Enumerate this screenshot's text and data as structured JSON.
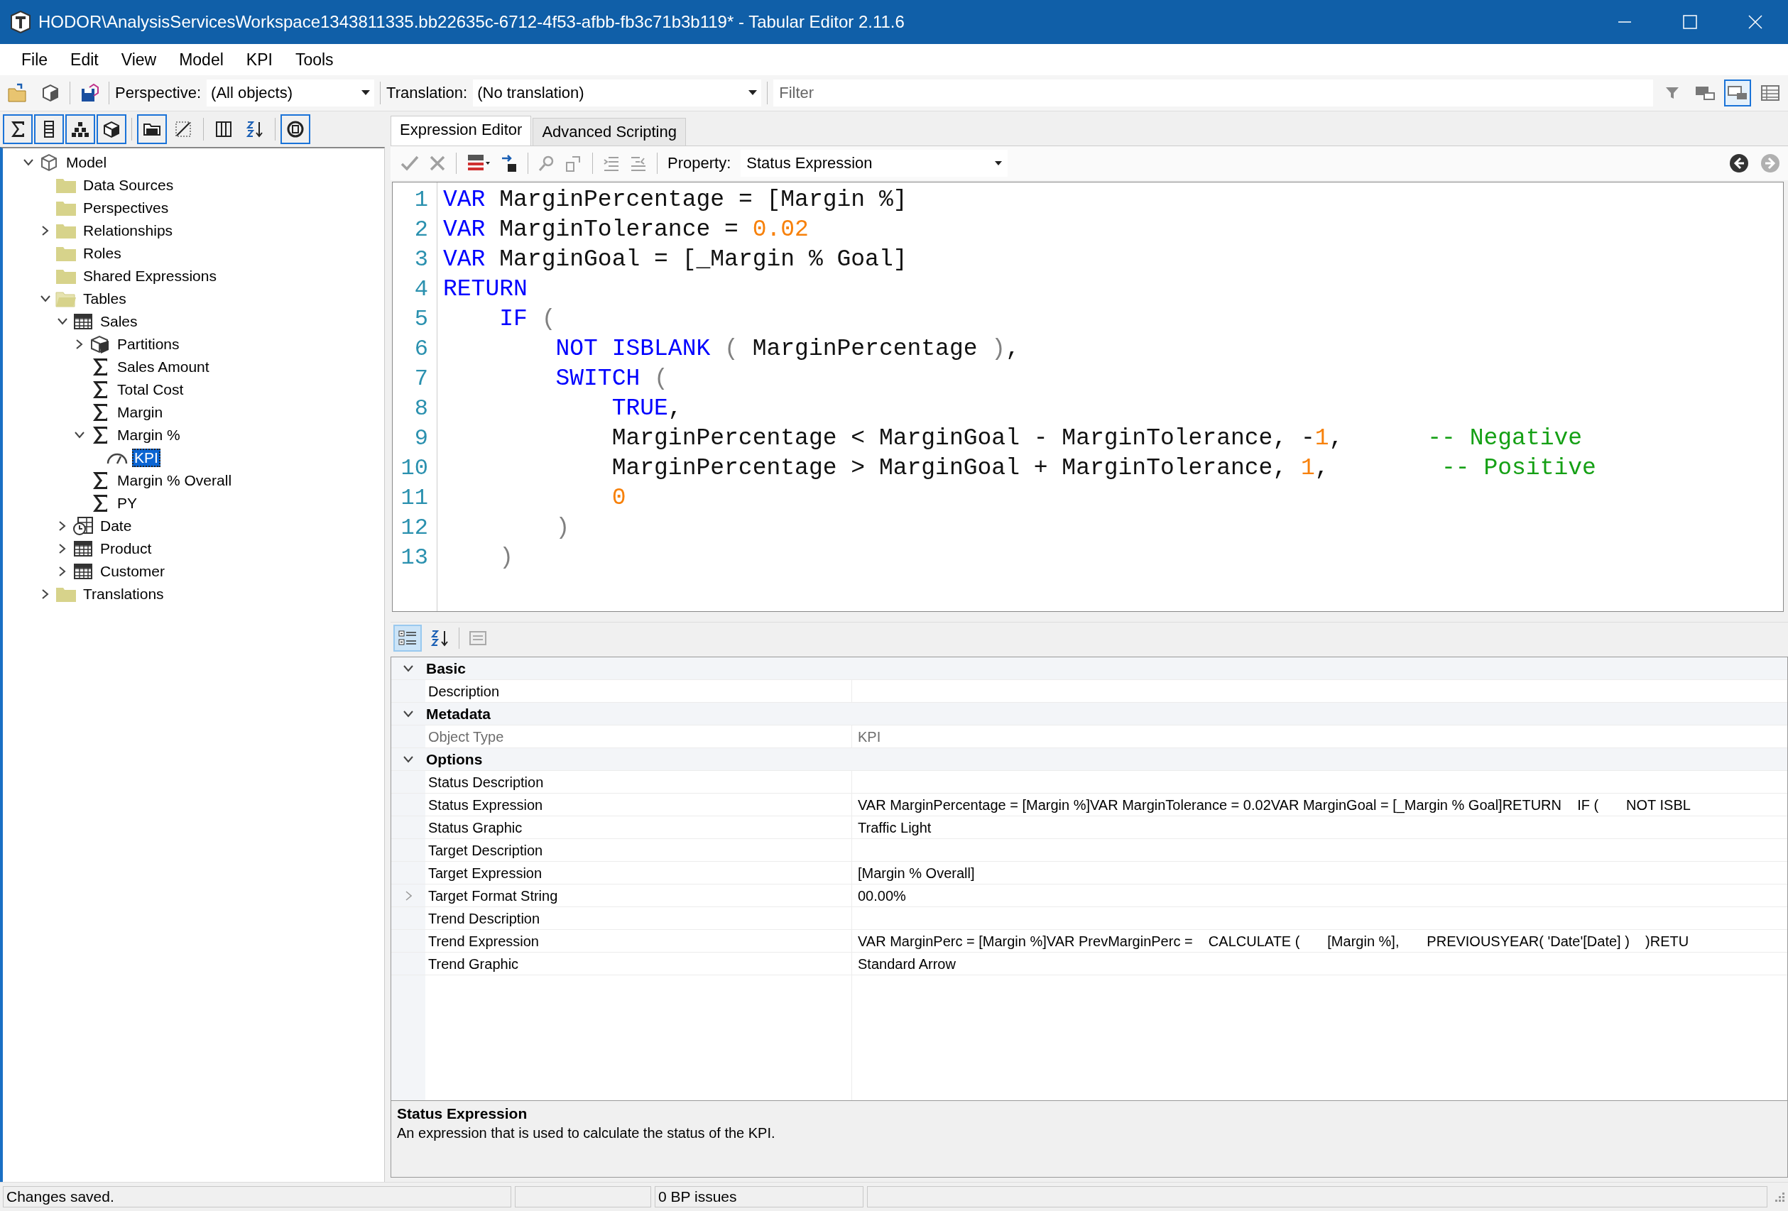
{
  "window": {
    "title": "HODOR\\AnalysisServicesWorkspace1343811335.bb22635c-6712-4f53-afbb-fb3c71b3b119* - Tabular Editor 2.11.6"
  },
  "menu": [
    "File",
    "Edit",
    "View",
    "Model",
    "KPI",
    "Tools"
  ],
  "toolbar": {
    "perspective": {
      "label": "Perspective:",
      "value": "(All objects)"
    },
    "translation": {
      "label": "Translation:",
      "value": "(No translation)"
    },
    "filter": {
      "placeholder": "Filter"
    },
    "view_buttons": [
      {
        "kind": "filter",
        "on": false
      },
      {
        "kind": "grid-view",
        "on": false
      },
      {
        "kind": "tree-view",
        "on": true
      },
      {
        "kind": "list-view",
        "on": false
      }
    ]
  },
  "tree_toolbar": [
    {
      "kind": "sigma",
      "on": true
    },
    {
      "kind": "column",
      "on": true
    },
    {
      "kind": "hierarchy",
      "on": true
    },
    {
      "kind": "cube",
      "on": true
    },
    {
      "kind": "folder",
      "on": true
    },
    {
      "kind": "diagonal",
      "on": false
    },
    {
      "kind": "columns",
      "on": false
    },
    {
      "kind": "sort",
      "on": false
    },
    {
      "kind": "circle",
      "on": true
    }
  ],
  "tree": [
    {
      "label": "Model",
      "kind": "model",
      "expanded": true,
      "selected": false,
      "children": [
        {
          "label": "Data Sources",
          "kind": "folder",
          "selected": false
        },
        {
          "label": "Perspectives",
          "kind": "folder",
          "selected": false
        },
        {
          "label": "Relationships",
          "kind": "folder",
          "expanded": false,
          "selected": false
        },
        {
          "label": "Roles",
          "kind": "folder",
          "selected": false
        },
        {
          "label": "Shared Expressions",
          "kind": "folder",
          "selected": false
        },
        {
          "label": "Tables",
          "kind": "folder-open",
          "expanded": true,
          "selected": false,
          "children": [
            {
              "label": "Sales",
              "kind": "table",
              "expanded": true,
              "selected": false,
              "children": [
                {
                  "label": "Partitions",
                  "kind": "partitions",
                  "expanded": false,
                  "selected": false
                },
                {
                  "label": "Sales Amount",
                  "kind": "measure",
                  "selected": false
                },
                {
                  "label": "Total Cost",
                  "kind": "measure",
                  "selected": false
                },
                {
                  "label": "Margin",
                  "kind": "measure",
                  "selected": false
                },
                {
                  "label": "Margin %",
                  "kind": "measure",
                  "expanded": true,
                  "selected": false,
                  "children": [
                    {
                      "label": "KPI",
                      "kind": "kpi",
                      "selected": true
                    }
                  ]
                },
                {
                  "label": "Margin % Overall",
                  "kind": "measure",
                  "selected": false
                },
                {
                  "label": "PY",
                  "kind": "measure",
                  "selected": false
                }
              ]
            },
            {
              "label": "Date",
              "kind": "date-table",
              "expanded": false,
              "selected": false
            },
            {
              "label": "Product",
              "kind": "table",
              "expanded": false,
              "selected": false
            },
            {
              "label": "Customer",
              "kind": "table",
              "expanded": false,
              "selected": false
            }
          ]
        },
        {
          "label": "Translations",
          "kind": "folder",
          "expanded": false,
          "selected": false
        }
      ]
    }
  ],
  "editor": {
    "tabs": [
      {
        "label": "Expression Editor",
        "selected": true
      },
      {
        "label": "Advanced Scripting",
        "selected": false
      }
    ],
    "property": {
      "label": "Property:",
      "value": "Status Expression"
    },
    "lines": [
      {
        "number": "1",
        "tokens": [
          {
            "text": "VAR",
            "kind": "keyword"
          },
          {
            "text": " MarginPercentage = [Margin %]",
            "kind": "plain"
          }
        ]
      },
      {
        "number": "2",
        "tokens": [
          {
            "text": "VAR",
            "kind": "keyword"
          },
          {
            "text": " MarginTolerance = ",
            "kind": "plain"
          },
          {
            "text": "0.02",
            "kind": "number"
          }
        ]
      },
      {
        "number": "3",
        "tokens": [
          {
            "text": "VAR",
            "kind": "keyword"
          },
          {
            "text": " MarginGoal = [_Margin % Goal]",
            "kind": "plain"
          }
        ]
      },
      {
        "number": "4",
        "tokens": [
          {
            "text": "RETURN",
            "kind": "keyword"
          }
        ]
      },
      {
        "number": "5",
        "tokens": [
          {
            "text": "    IF",
            "kind": "keyword"
          },
          {
            "text": " (",
            "kind": "paren"
          }
        ]
      },
      {
        "number": "6",
        "tokens": [
          {
            "text": "        NOT ISBLANK",
            "kind": "keyword"
          },
          {
            "text": " (",
            "kind": "paren"
          },
          {
            "text": " MarginPercentage",
            "kind": "plain"
          },
          {
            "text": " )",
            "kind": "paren"
          },
          {
            "text": ",",
            "kind": "plain"
          }
        ]
      },
      {
        "number": "7",
        "tokens": [
          {
            "text": "        SWITCH",
            "kind": "keyword"
          },
          {
            "text": " (",
            "kind": "paren"
          }
        ]
      },
      {
        "number": "8",
        "tokens": [
          {
            "text": "            TRUE",
            "kind": "keyword"
          },
          {
            "text": ",",
            "kind": "plain"
          }
        ]
      },
      {
        "number": "9",
        "tokens": [
          {
            "text": "            MarginPercentage < MarginGoal - MarginTolerance, -",
            "kind": "plain"
          },
          {
            "text": "1",
            "kind": "number"
          },
          {
            "text": ",",
            "kind": "plain"
          },
          {
            "text": "      -- Negative",
            "kind": "comment"
          }
        ]
      },
      {
        "number": "10",
        "tokens": [
          {
            "text": "            MarginPercentage > MarginGoal + MarginTolerance, ",
            "kind": "plain"
          },
          {
            "text": "1",
            "kind": "number"
          },
          {
            "text": ",",
            "kind": "plain"
          },
          {
            "text": "        -- Positive",
            "kind": "comment"
          }
        ]
      },
      {
        "number": "11",
        "tokens": [
          {
            "text": "            0",
            "kind": "number"
          }
        ]
      },
      {
        "number": "12",
        "tokens": [
          {
            "text": "        )",
            "kind": "paren"
          }
        ]
      },
      {
        "number": "13",
        "tokens": [
          {
            "text": "    )",
            "kind": "paren"
          }
        ]
      }
    ]
  },
  "properties": {
    "toolbar": [
      {
        "kind": "categorized",
        "on": true
      },
      {
        "kind": "alphabetical",
        "on": false
      },
      {
        "kind": "pages",
        "on": false
      }
    ],
    "categories": [
      {
        "name": "Basic",
        "expanded": true,
        "rows": [
          {
            "label": "Description",
            "disabled": false
          }
        ]
      },
      {
        "name": "Metadata",
        "expanded": true,
        "rows": [
          {
            "label": "Object Type",
            "value": "KPI",
            "disabled": true
          }
        ]
      },
      {
        "name": "Options",
        "expanded": true,
        "rows": [
          {
            "label": "Status Description",
            "disabled": false
          },
          {
            "label": "Status Expression",
            "value": "VAR MarginPercentage = [Margin %]VAR MarginTolerance = 0.02VAR MarginGoal = [_Margin % Goal]RETURN    IF (       NOT ISBL",
            "disabled": false
          },
          {
            "label": "Status Graphic",
            "value": "Traffic Light",
            "disabled": false
          },
          {
            "label": "Target Description",
            "disabled": false
          },
          {
            "label": "Target Expression",
            "value": "[Margin % Overall]",
            "disabled": false
          },
          {
            "label": "Target Format String",
            "value": "00.00%",
            "expanded": false,
            "disabled": false
          },
          {
            "label": "Trend Description",
            "disabled": false
          },
          {
            "label": "Trend Expression",
            "value": "VAR MarginPerc = [Margin %]VAR PrevMarginPerc =    CALCULATE (       [Margin %],       PREVIOUSYEAR( 'Date'[Date] )    )RETU",
            "disabled": false
          },
          {
            "label": "Trend Graphic",
            "value": "Standard Arrow",
            "disabled": false
          }
        ]
      }
    ]
  },
  "description": {
    "title": "Status Expression",
    "text": "An expression that is used to calculate the status of the KPI."
  },
  "status_bar": {
    "message": "Changes saved.",
    "issues": "0 BP issues"
  }
}
